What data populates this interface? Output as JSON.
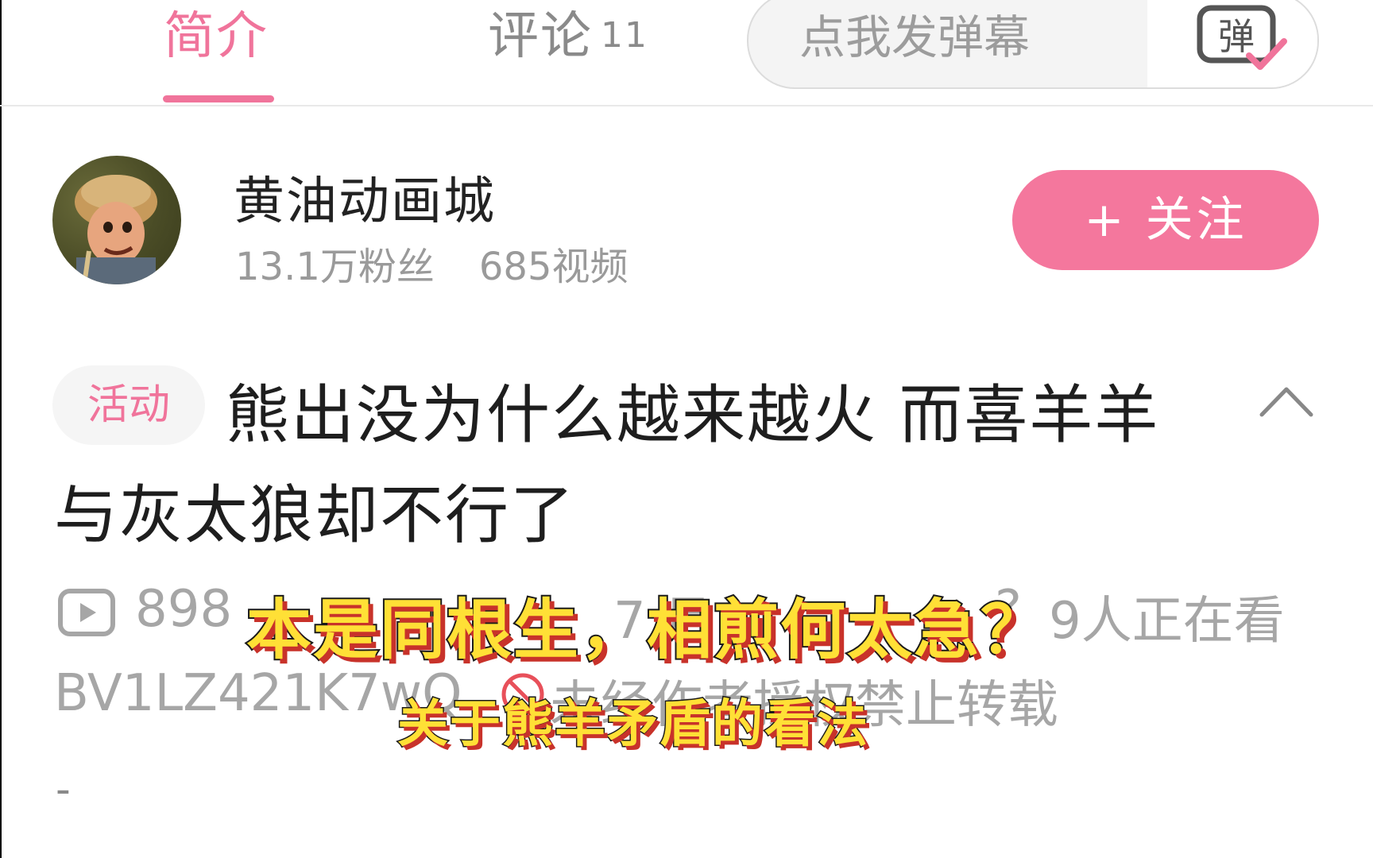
{
  "tabs": {
    "intro_label": "简介",
    "comments_label": "评论",
    "comments_count": "11",
    "active_color": "#f0749b"
  },
  "danmaku": {
    "placeholder": "点我发弹幕",
    "button_glyph": "弹"
  },
  "uploader": {
    "name": "黄油动画城",
    "followers": "13.1万粉丝",
    "videos": "685视频",
    "follow_label": "+ 关注"
  },
  "video": {
    "badge": "活动",
    "title_line1": "熊出没为什么越来越火 而喜羊羊",
    "title_line2": "与灰太狼却不行了",
    "views": "898",
    "date_fragment": "7 月",
    "watch_fragment": "?",
    "watching": "9人正在看",
    "bvid": "BV1LZ421K7wQ",
    "reprint_notice": "未经作者授权禁止转载",
    "description": "-"
  },
  "subtitles": {
    "main": "本是同根生，相煎何太急？",
    "secondary": "关于熊羊矛盾的看法"
  },
  "icons": {
    "play": "play-icon",
    "ban": "ban-icon",
    "collapse": "chevron-up-icon",
    "danmaku": "danmaku-icon"
  }
}
